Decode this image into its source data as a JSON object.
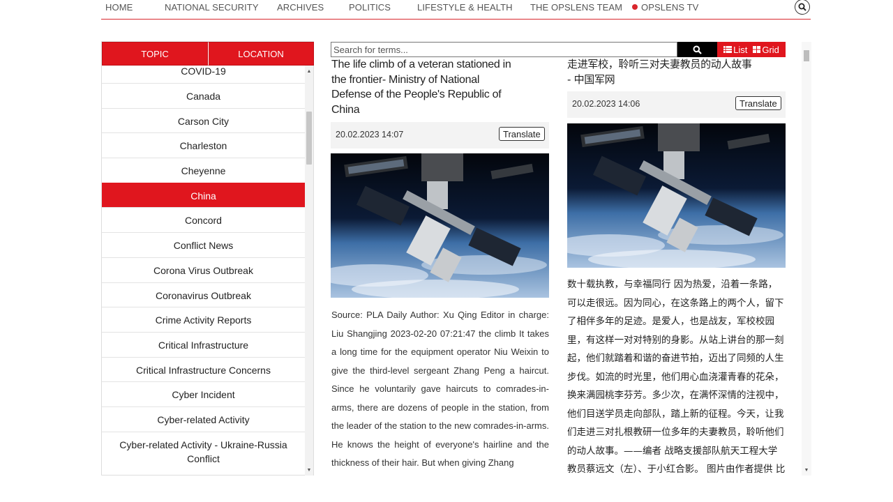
{
  "nav": {
    "items": [
      "HOME",
      "NATIONAL SECURITY",
      "ARCHIVES",
      "POLITICS",
      "LIFESTYLE & HEALTH",
      "THE OPSLENS TEAM",
      "OPSLENS TV"
    ],
    "tv_dot_color": "#d9262c",
    "search_icon": "search-icon"
  },
  "filters": {
    "tabs": [
      "TOPIC",
      "LOCATION"
    ],
    "locations": [
      "COVID-19",
      "Canada",
      "Carson City",
      "Charleston",
      "Cheyenne",
      "China",
      "Concord",
      "Conflict News",
      "Corona Virus Outbreak",
      "Coronavirus Outbreak",
      "Crime Activity Reports",
      "Critical Infrastructure",
      "Critical Infrastructure Concerns",
      "Cyber Incident",
      "Cyber-related Activity",
      "Cyber-related Activity - Ukraine-Russia Conflict"
    ],
    "active_location": "China"
  },
  "search": {
    "placeholder": "Search for terms...",
    "list_label": "List",
    "grid_label": "Grid"
  },
  "articles": [
    {
      "title": "The life climb of a veteran stationed in the frontier- Ministry of National Defense of the People's Republic of China",
      "date": "20.02.2023 14:07",
      "translate_label": "Translate",
      "body": "Source: PLA Daily Author: Xu Qing Editor in charge: Liu Shangjing 2023-02-20 07:21:47 the climb It takes a long time for the equipment operator Niu Weixin to give the third-level sergeant Zhang Peng a haircut. Since he voluntarily gave haircuts to comrades-in-arms, there are dozens of people in the station, from the leader of the station to the new comrades-in-arms. He knows the height of everyone's hairline and the thickness of their hair. But when giving Zhang"
    },
    {
      "title": "走进军校，聆听三对夫妻教员的动人故事 - 中国军网",
      "date": "20.02.2023 14:06",
      "translate_label": "Translate",
      "body": "数十载执教，与幸福同行 因为热爱，沿着一条路，可以走很远。因为同心，在这条路上的两个人，留下了相伴多年的足迹。是爱人，也是战友，军校校园里，有这样一对对特别的身影。从站上讲台的那一刻起，他们就踏着和谐的奋进节拍，迈出了同频的人生步伐。如流的时光里，他们用心血浇灌青春的花朵，换来满园桃李芬芳。多少次，在满怀深情的注视中，他们目送学员走向部队，踏上新的征程。今天，让我们走进三对扎根教研一位多年的夫妻教员，聆听他们的动人故事。——编者 战略支援部队航天工程大学教员蔡远文（左）、于小红合影。 图片由作者提供 比翼齐飞，共育英才 谭安"
    }
  ]
}
